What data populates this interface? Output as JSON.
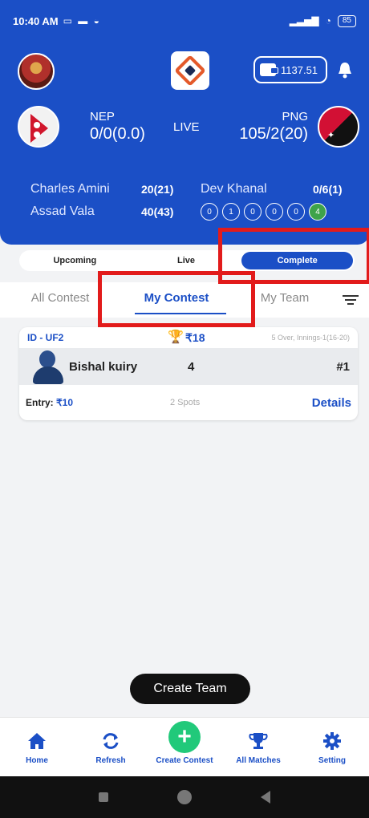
{
  "status_bar": {
    "time": "10:40 AM",
    "battery": "85"
  },
  "wallet": {
    "balance": "1137.51"
  },
  "match": {
    "status": "LIVE",
    "team_left": {
      "code": "NEP",
      "score": "0/0(0.0)"
    },
    "team_right": {
      "code": "PNG",
      "score": "105/2(20)"
    }
  },
  "batters": [
    {
      "name": "Charles Amini",
      "stat": "20(21)"
    },
    {
      "name": "Assad Vala",
      "stat": "40(43)"
    }
  ],
  "bowler": {
    "name": "Dev Khanal",
    "stat": "0/6(1)"
  },
  "balls": [
    "0",
    "1",
    "0",
    "0",
    "0",
    "4"
  ],
  "segments": [
    {
      "label": "Upcoming"
    },
    {
      "label": "Live"
    },
    {
      "label": "Complete"
    }
  ],
  "tabs": [
    {
      "label": "All Contest"
    },
    {
      "label": "My Contest"
    },
    {
      "label": "My Team"
    }
  ],
  "contest": {
    "id": "ID - UF2",
    "prize": "₹18",
    "meta": "5 Over, Innings-1(16-20)",
    "user": "Bishal kuiry",
    "points": "4",
    "rank": "#1",
    "entry_label": "Entry:",
    "entry_amount": "₹10",
    "spots": "2 Spots",
    "details": "Details"
  },
  "create_team": "Create Team",
  "bottom_nav": [
    {
      "label": "Home",
      "icon": "home-icon"
    },
    {
      "label": "Refresh",
      "icon": "refresh-icon"
    },
    {
      "label": "Create Contest",
      "icon": "plus-icon"
    },
    {
      "label": "All Matches",
      "icon": "trophy-icon"
    },
    {
      "label": "Setting",
      "icon": "gear-icon"
    }
  ],
  "colors": {
    "primary": "#1b4fc6",
    "green": "#21c97a",
    "highlight": "#e21b1b",
    "ball_four": "#3ea34a"
  }
}
